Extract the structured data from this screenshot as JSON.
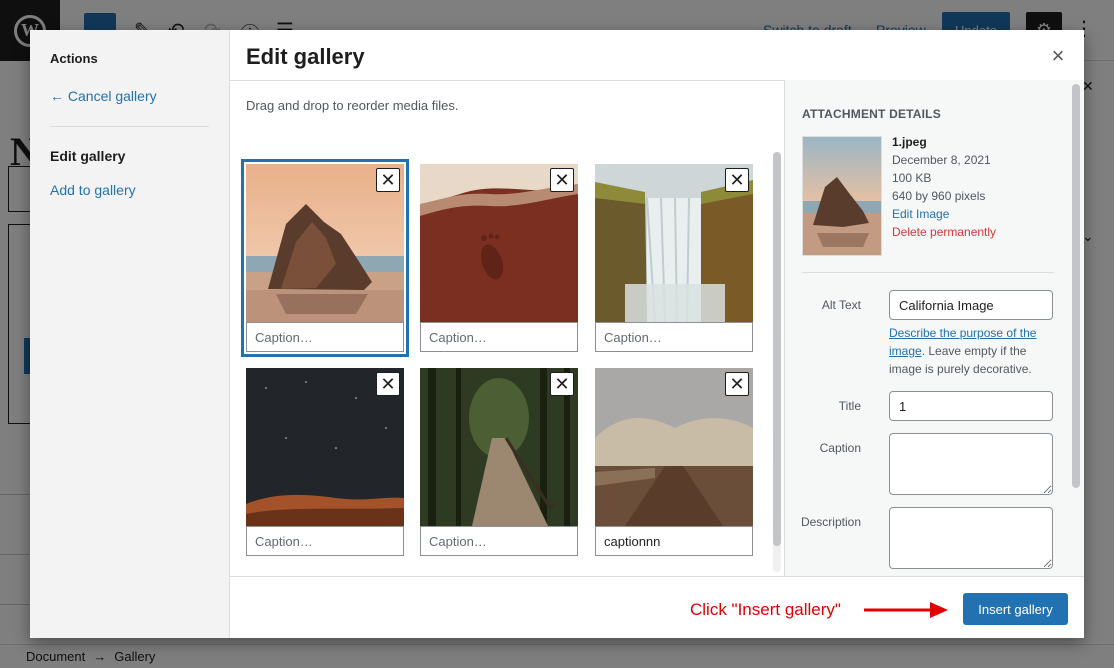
{
  "editor": {
    "title_initial": "N",
    "toolbar_links": {
      "switch_to_draft": "Switch to draft",
      "preview": "Preview"
    },
    "update_label": "Update",
    "breadcrumb": [
      "Document",
      "Gallery"
    ]
  },
  "modal": {
    "title": "Edit gallery",
    "close_glyph": "×",
    "instructions": "Drag and drop to reorder media files.",
    "sidebar": {
      "heading": "Actions",
      "cancel_label": "← Cancel gallery",
      "edit_label": "Edit gallery",
      "add_label": "Add to gallery"
    },
    "gallery": {
      "caption_placeholder": "Caption…",
      "remove_glyph": "✕",
      "items": [
        {
          "caption": "",
          "scene": "rock-beach",
          "selected": true
        },
        {
          "caption": "",
          "scene": "footprint-sand",
          "selected": false
        },
        {
          "caption": "",
          "scene": "waterfall",
          "selected": false
        },
        {
          "caption": "",
          "scene": "night-desert",
          "selected": false
        },
        {
          "caption": "",
          "scene": "forest-boardwalk",
          "selected": false
        },
        {
          "caption": "captionnn",
          "scene": "desert-road",
          "selected": false
        }
      ]
    },
    "details": {
      "heading": "Attachment Details",
      "filename": "1.jpeg",
      "date": "December 8, 2021",
      "size": "100 KB",
      "dimensions": "640 by 960 pixels",
      "edit_image": "Edit Image",
      "delete_permanently": "Delete permanently",
      "alt_text_label": "Alt Text",
      "alt_text_value": "California Image",
      "alt_help_link": "Describe the purpose of the image",
      "alt_help_rest": ". Leave empty if the image is purely decorative.",
      "title_label": "Title",
      "title_value": "1",
      "caption_label": "Caption",
      "caption_value": "",
      "description_label": "Description",
      "description_value": ""
    },
    "footer": {
      "annotation": "Click \"Insert gallery\"",
      "insert_label": "Insert gallery"
    }
  },
  "colors": {
    "accent": "#2271b1",
    "danger": "#d63638",
    "annotation": "#e00000"
  }
}
